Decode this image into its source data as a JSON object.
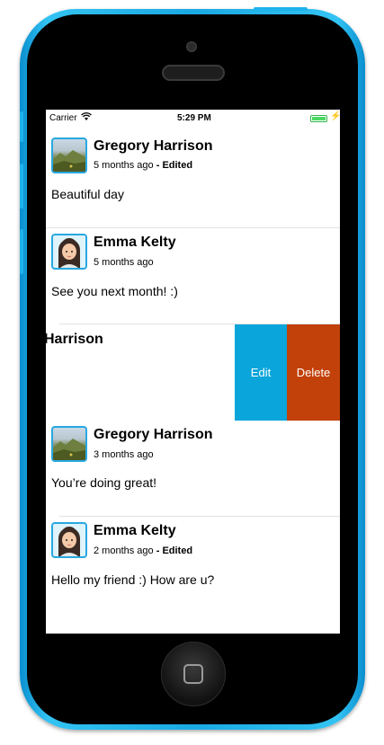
{
  "status_bar": {
    "carrier": "Carrier",
    "time": "5:29 PM"
  },
  "posts": [
    {
      "author": "Gregory Harrison",
      "time": "5 months ago",
      "edited": "- Edited",
      "text": "Beautiful day",
      "avatar": "landscape-avatar"
    },
    {
      "author": "Emma Kelty",
      "time": "5 months ago",
      "edited": "",
      "text": "See you next month! :)",
      "avatar": "woman-avatar"
    },
    {
      "author": "Harrison"
    },
    {
      "author": "Gregory Harrison",
      "time": "3 months ago",
      "edited": "",
      "text": "You’re doing great!",
      "avatar": "landscape-avatar"
    },
    {
      "author": "Emma Kelty",
      "time": "2 months ago",
      "edited": "- Edited",
      "text": "Hello my friend :) How are u?",
      "avatar": "woman-avatar"
    }
  ],
  "swipe_actions": {
    "edit_label": "Edit",
    "delete_label": "Delete"
  },
  "colors": {
    "frame": "#1fb3ec",
    "avatar_border": "#27a8e0",
    "edit": "#0aa5db",
    "delete": "#c2410a",
    "battery": "#4cd964"
  }
}
